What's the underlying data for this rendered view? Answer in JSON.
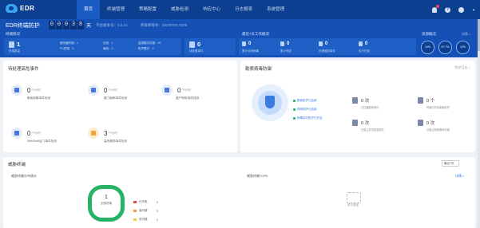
{
  "app": {
    "logo_text": "EDR"
  },
  "nav": {
    "items": [
      "首页",
      "终端管理",
      "策略配置",
      "威胁检测",
      "响应中心",
      "日志报表",
      "系统管理"
    ]
  },
  "banner": {
    "title": "EDR终端防护",
    "counter_digits": [
      "0",
      "0",
      "0",
      "3",
      "8"
    ],
    "counter_unit": "天",
    "version": "平台版本号：3.2.21",
    "library": "病毒库版本：20230701.0326",
    "terminal_section": "终端情况",
    "terminal_main": {
      "value": "1",
      "label": "终端数量"
    },
    "terminal_minis": [
      "服务器终端：1",
      "PC终端：0",
      "在线：1",
      "离线：0",
      "监测模式终端：40",
      "防护模式：0"
    ],
    "threat_main": {
      "value": "0",
      "label": "待处置事件"
    },
    "recent_section": "最近7天工作概况",
    "recent_stats": [
      {
        "value": "0",
        "label": "累计检测病毒"
      },
      {
        "value": "0",
        "label": "累计修复"
      },
      {
        "value": "0",
        "label": "处理威胁事件"
      },
      {
        "value": "0",
        "label": "执行扫描"
      }
    ],
    "overview_section": "资源概况",
    "overview_link": "详情 >",
    "rings": [
      {
        "value": "13%",
        "label": "CPU"
      },
      {
        "value": "57.7%",
        "label": "内存"
      },
      {
        "value": "12%",
        "label": "磁盘"
      }
    ]
  },
  "panel_events": {
    "title": "待处理高危事件",
    "items": [
      {
        "value": "0",
        "unit": "个/小时",
        "label": "勒索病毒/事件检测"
      },
      {
        "value": "0",
        "unit": "个/小时",
        "label": "暴力破解/事件检测"
      },
      {
        "value": "0",
        "unit": "个/小时",
        "label": "僵尸网络/事件检测"
      },
      {
        "value": "0",
        "unit": "个/小时",
        "label": "WebShell后门/事件检测"
      },
      {
        "value": "3",
        "unit": "个/小时",
        "label": "高危漏洞/事件检测"
      }
    ]
  },
  "panel_security": {
    "title": "勒索病毒防御",
    "more": "防护日志 >",
    "checks": [
      "勒索防护已启用",
      "诱饵防护已启用",
      "病毒实时防护已开启"
    ],
    "stats": [
      {
        "value": "0 次",
        "label": "已拦截勒索事件"
      },
      {
        "value": "0 个",
        "label": "终端已开启勒索防护"
      },
      {
        "value": "0 次",
        "label": "已阻止异常加密操作"
      },
      {
        "value": "0 次",
        "label": "已阻止勒索横向传播"
      }
    ]
  },
  "panel_threat": {
    "title": "威胁终端",
    "select": "最近7天",
    "left_tab": "威胁终端分布统计",
    "right_tab": "威胁终端TOP5",
    "right_more": "详情 >",
    "donut_value": "1",
    "donut_label": "全部终端",
    "legend": [
      {
        "name": "已失陷",
        "value": "0",
        "color": "#e24a4a"
      },
      {
        "name": "高可疑",
        "value": "0",
        "color": "#f29a3c"
      },
      {
        "name": "低可疑",
        "value": "0",
        "color": "#f2c94c"
      }
    ],
    "empty_text": "暂无数据"
  }
}
